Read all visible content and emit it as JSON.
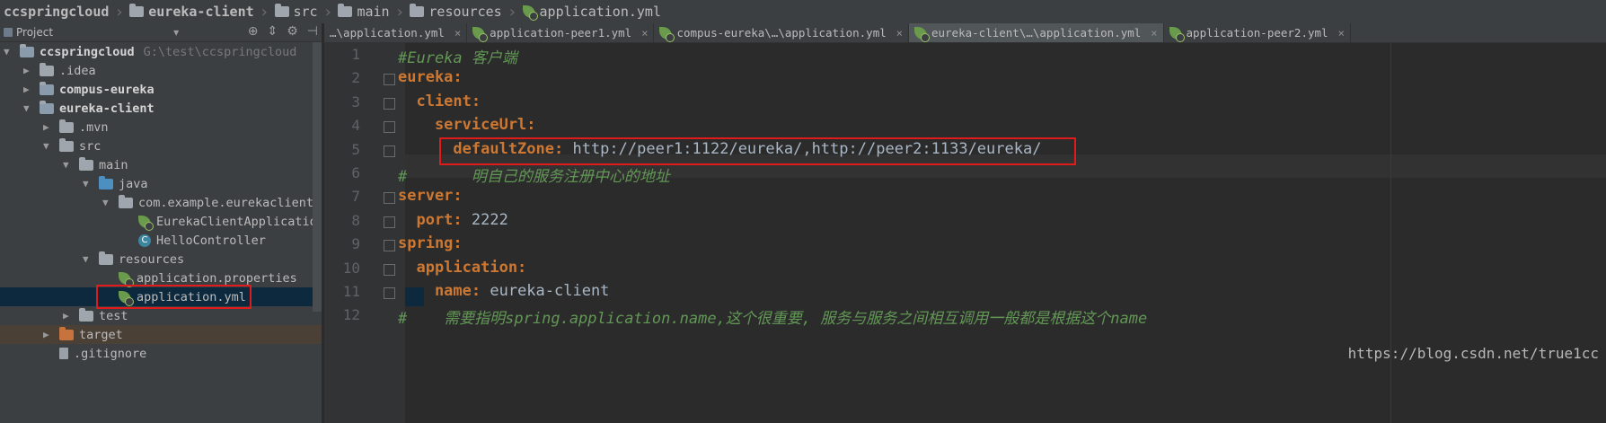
{
  "breadcrumbs": [
    "ccspringcloud",
    "eureka-client",
    "src",
    "main",
    "resources",
    "application.yml"
  ],
  "project_panel": {
    "title": "Project",
    "tree": [
      {
        "label": "ccspringcloud",
        "path": "G:\\test\\ccspringcloud",
        "bold": true,
        "depth": 0,
        "expanded": true,
        "icon": "module-folder-icon"
      },
      {
        "label": ".idea",
        "depth": 1,
        "expanded": false,
        "icon": "folder-icon"
      },
      {
        "label": "compus-eureka",
        "bold": true,
        "depth": 1,
        "expanded": false,
        "icon": "module-folder-icon"
      },
      {
        "label": "eureka-client",
        "bold": true,
        "depth": 1,
        "expanded": true,
        "icon": "module-folder-icon"
      },
      {
        "label": ".mvn",
        "depth": 2,
        "expanded": false,
        "icon": "folder-icon"
      },
      {
        "label": "src",
        "depth": 2,
        "expanded": true,
        "icon": "folder-icon"
      },
      {
        "label": "main",
        "depth": 3,
        "expanded": true,
        "icon": "folder-icon"
      },
      {
        "label": "java",
        "depth": 4,
        "expanded": true,
        "icon": "source-folder-icon"
      },
      {
        "label": "com.example.eurekaclient",
        "depth": 5,
        "expanded": true,
        "icon": "package-icon"
      },
      {
        "label": "EurekaClientApplication",
        "depth": 6,
        "icon": "spring-class-icon"
      },
      {
        "label": "HelloController",
        "depth": 6,
        "icon": "class-icon"
      },
      {
        "label": "resources",
        "depth": 4,
        "expanded": true,
        "icon": "resources-folder-icon"
      },
      {
        "label": "application.properties",
        "depth": 5,
        "icon": "spring-config-icon"
      },
      {
        "label": "application.yml",
        "depth": 5,
        "icon": "spring-config-icon",
        "selected": true
      },
      {
        "label": "test",
        "depth": 3,
        "expanded": false,
        "icon": "folder-icon"
      },
      {
        "label": "target",
        "depth": 2,
        "expanded": false,
        "icon": "excluded-folder-icon"
      },
      {
        "label": ".gitignore",
        "depth": 2,
        "icon": "file-icon"
      }
    ]
  },
  "tabs": [
    {
      "label": "…\\application.yml"
    },
    {
      "label": "application-peer1.yml"
    },
    {
      "label": "compus-eureka\\…\\application.yml"
    },
    {
      "label": "eureka-client\\…\\application.yml",
      "active": true
    },
    {
      "label": "application-peer2.yml"
    }
  ],
  "editor": {
    "lines": [
      {
        "n": "1",
        "parts": [
          {
            "t": "#Eureka 客户端",
            "c": "cm"
          }
        ]
      },
      {
        "n": "2",
        "parts": [
          {
            "t": "eureka:",
            "c": "k"
          }
        ]
      },
      {
        "n": "3",
        "parts": [
          {
            "t": "  client:",
            "c": "k"
          }
        ]
      },
      {
        "n": "4",
        "parts": [
          {
            "t": "    serviceUrl:",
            "c": "k"
          }
        ]
      },
      {
        "n": "5",
        "parts": [
          {
            "t": "      defaultZone: ",
            "c": "k"
          },
          {
            "t": "http://peer1:1122/eureka/,http://peer2:1133/eureka/",
            "c": "v"
          }
        ]
      },
      {
        "n": "6",
        "parts": [
          {
            "t": "#       明自己的服务注册中心的地址",
            "c": "cm"
          }
        ]
      },
      {
        "n": "7",
        "parts": [
          {
            "t": "server:",
            "c": "k"
          }
        ]
      },
      {
        "n": "8",
        "parts": [
          {
            "t": "  port: ",
            "c": "k"
          },
          {
            "t": "2222",
            "c": "v"
          }
        ]
      },
      {
        "n": "9",
        "parts": [
          {
            "t": "spring:",
            "c": "k"
          }
        ]
      },
      {
        "n": "10",
        "parts": [
          {
            "t": "  application:",
            "c": "k"
          }
        ]
      },
      {
        "n": "11",
        "parts": [
          {
            "t": "    name: ",
            "c": "k"
          },
          {
            "t": "eureka-client",
            "c": "v"
          }
        ]
      },
      {
        "n": "12",
        "parts": [
          {
            "t": "#    需要指明spring.application.name,这个很重要, 服务与服务之间相互调用一般都是根据这个name",
            "c": "cm"
          }
        ]
      }
    ],
    "current_line": 5
  },
  "watermark": "https://blog.csdn.net/true1cc",
  "colors": {
    "keyword": "#cc7832",
    "comment": "#629755",
    "highlight_box": "#e01b1b",
    "selection": "#0d293e"
  }
}
